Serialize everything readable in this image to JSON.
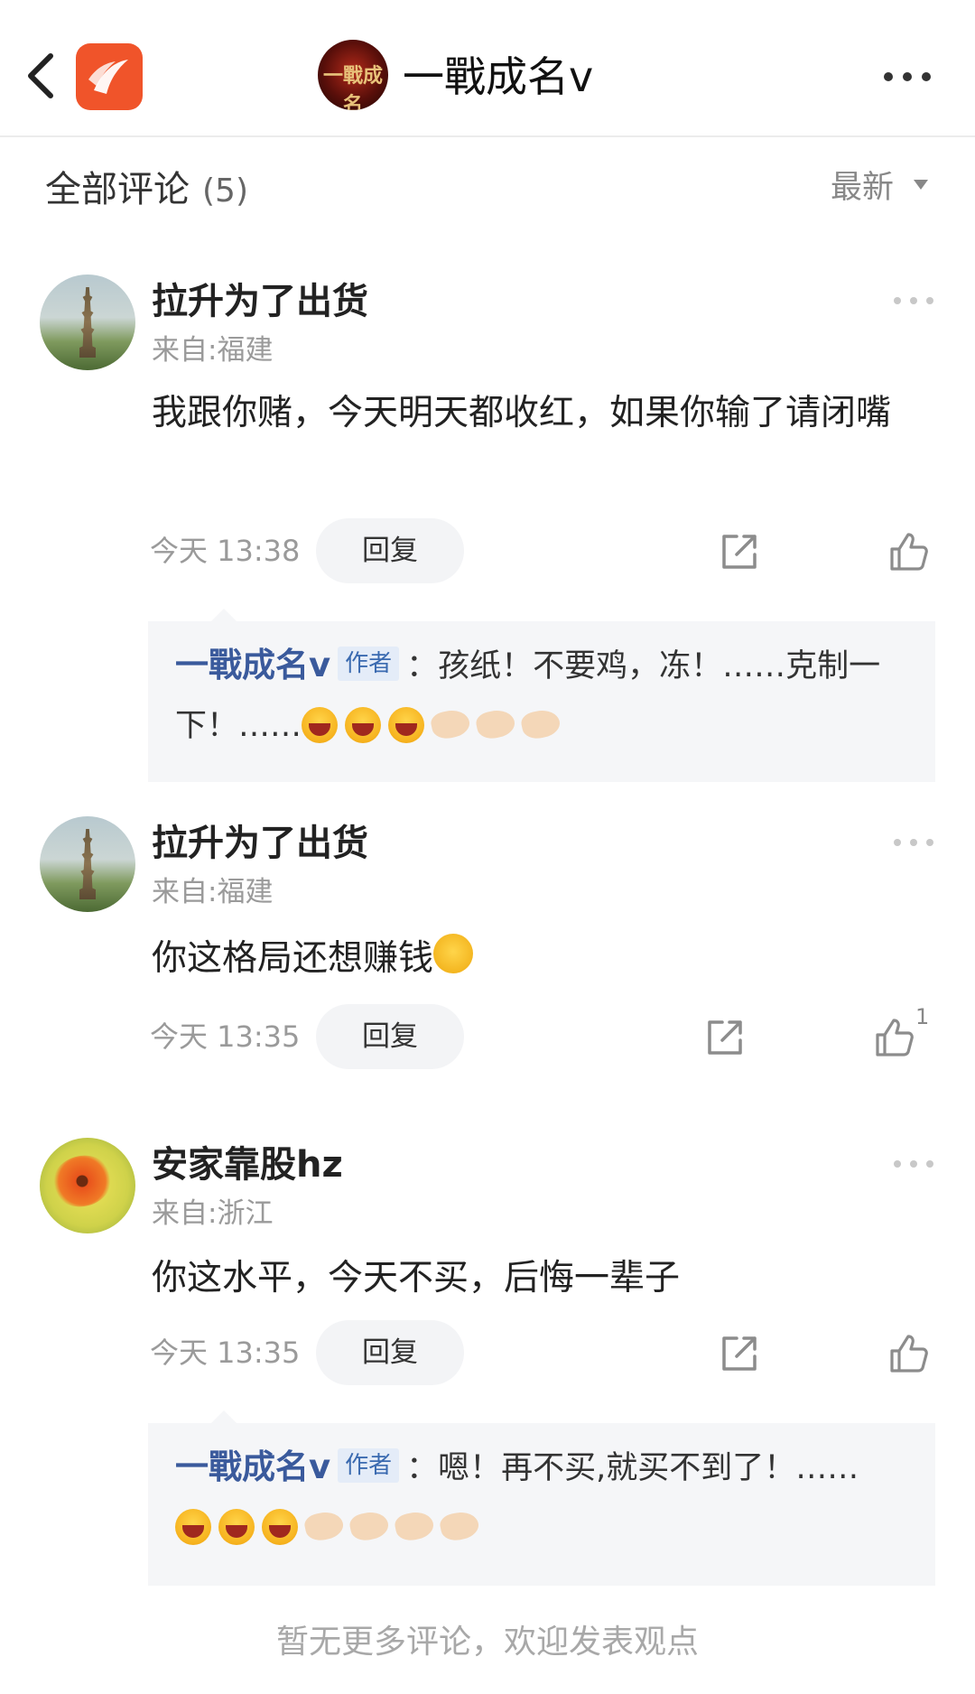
{
  "header": {
    "title": "一戰成名v",
    "avatar_text": "一戰成名"
  },
  "section": {
    "title": "全部评论",
    "count": "(5)",
    "sort_label": "最新"
  },
  "comments": [
    {
      "username": "拉升为了出货",
      "location": "来自:福建",
      "content": "我跟你赌，今天明天都收红，如果你输了请闭嘴",
      "time": "今天 13:38",
      "reply_label": "回复",
      "likes": "",
      "author_reply": {
        "name": "一戰成名v",
        "badge": "作者",
        "text": "：孩纸！不要鸡，冻！……克制一下！……"
      }
    },
    {
      "username": "拉升为了出货",
      "location": "来自:福建",
      "content": "你这格局还想赚钱",
      "time": "今天 13:35",
      "reply_label": "回复",
      "likes": "1"
    },
    {
      "username": "安家靠股hz",
      "location": "来自:浙江",
      "content": "你这水平，今天不买，后悔一辈子",
      "time": "今天 13:35",
      "reply_label": "回复",
      "likes": "",
      "author_reply": {
        "name": "一戰成名v",
        "badge": "作者",
        "text": "：嗯！再不买,就买不到了！……"
      }
    }
  ],
  "footer": {
    "text": "暂无更多评论，欢迎发表观点"
  },
  "colors": {
    "accent": "#3a5a9c",
    "logo": "#f0542a"
  }
}
